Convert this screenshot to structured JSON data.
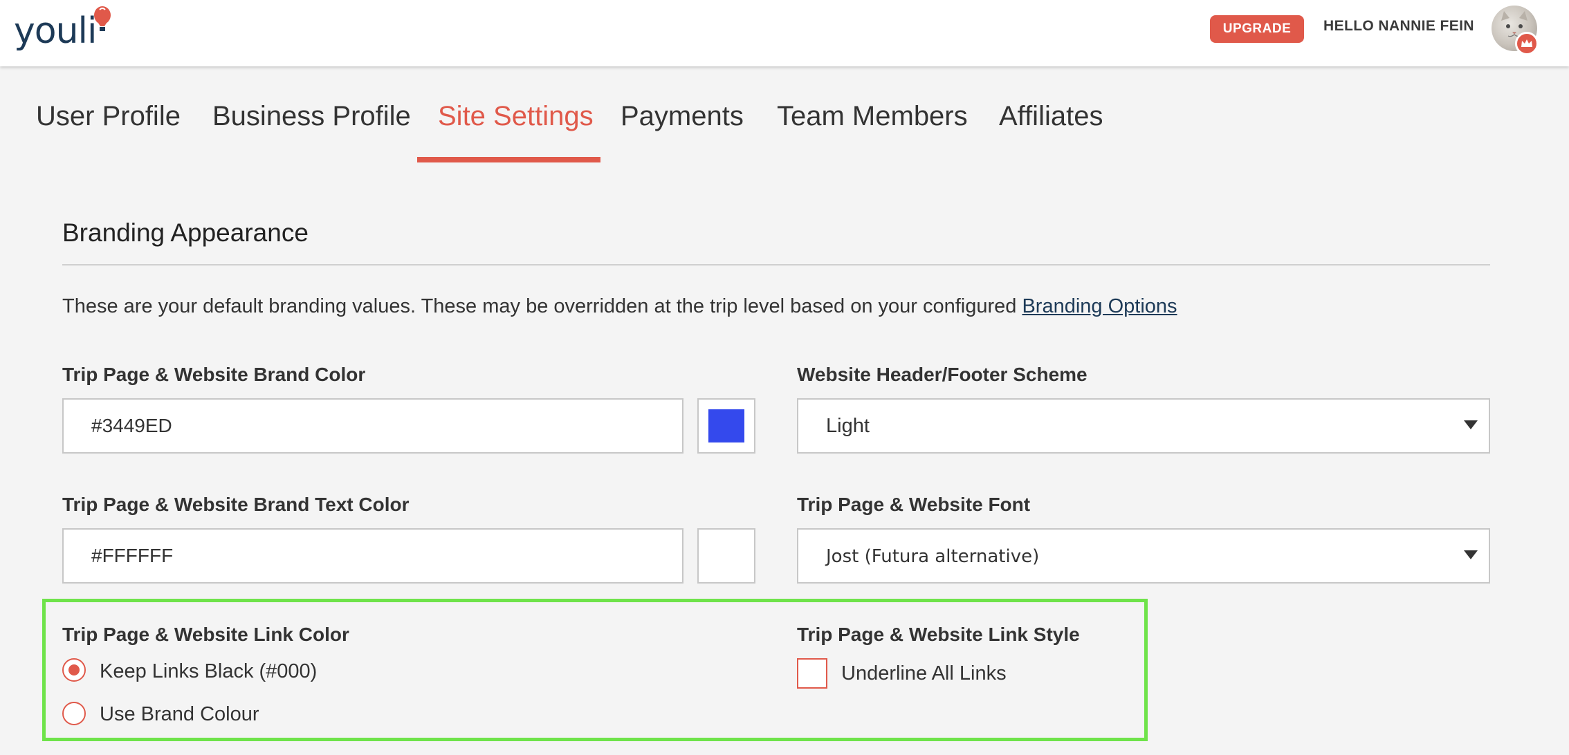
{
  "header": {
    "logo_text": "youli",
    "upgrade_label": "UPGRADE",
    "greeting": "HELLO NANNIE FEIN",
    "accent_color": "#e0594a"
  },
  "tabs": [
    {
      "label": "User Profile",
      "active": false
    },
    {
      "label": "Business Profile",
      "active": false
    },
    {
      "label": "Site Settings",
      "active": true
    },
    {
      "label": "Payments",
      "active": false
    },
    {
      "label": "Team Members",
      "active": false
    },
    {
      "label": "Affiliates",
      "active": false
    }
  ],
  "section": {
    "title": "Branding Appearance",
    "intro_text": "These are your default branding values. These may be overridden at the trip level based on your configured ",
    "intro_link": "Branding Options"
  },
  "fields": {
    "brand_color": {
      "label": "Trip Page & Website Brand Color",
      "value": "#3449ED",
      "swatch": "#3449ED"
    },
    "brand_text_color": {
      "label": "Trip Page & Website Brand Text Color",
      "value": "#FFFFFF",
      "swatch": "#FFFFFF"
    },
    "header_footer_scheme": {
      "label": "Website Header/Footer Scheme",
      "value": "Light"
    },
    "font": {
      "label": "Trip Page & Website Font",
      "value": "Jost (Futura alternative)"
    }
  },
  "link_color": {
    "label": "Trip Page & Website Link Color",
    "options": [
      {
        "label": "Keep Links Black (#000)",
        "checked": true
      },
      {
        "label": "Use Brand Colour",
        "checked": false
      }
    ]
  },
  "link_style": {
    "label": "Trip Page & Website Link Style",
    "underline_label": "Underline All Links",
    "checked": false
  }
}
